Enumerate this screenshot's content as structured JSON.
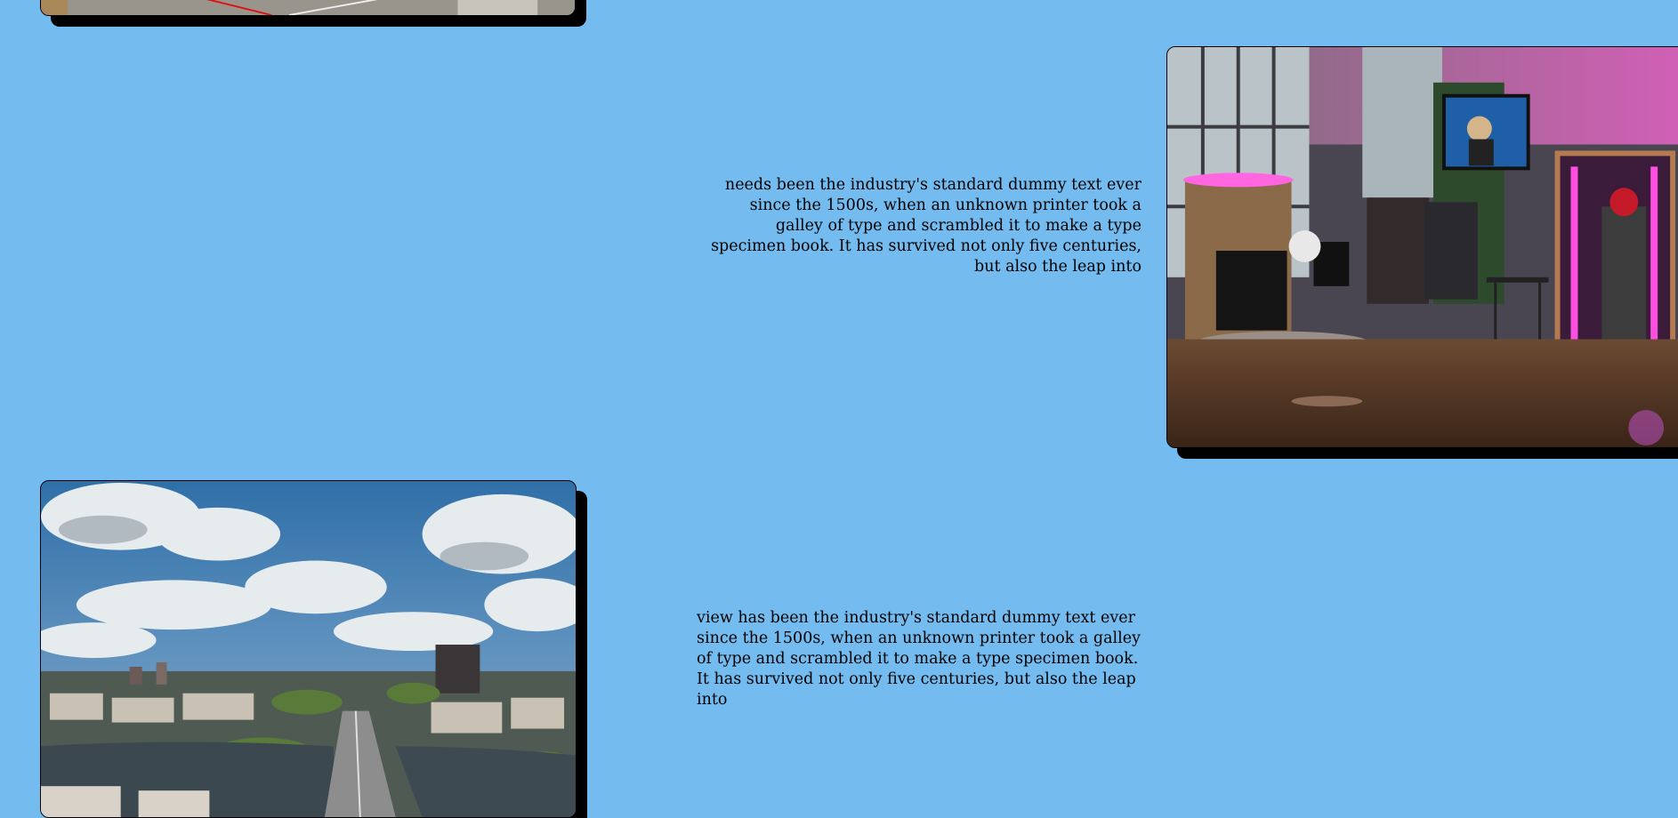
{
  "page": {
    "background_color": "#74bbef"
  },
  "top_card": {
    "image_alt": "road scene with painted lines"
  },
  "store_card": {
    "image_alt": "store interior with neon booth"
  },
  "city_card": {
    "image_alt": "aerial city view with clouds and canal"
  },
  "paragraph_1": {
    "text": "needs been the industry's standard dummy text ever since the 1500s, when an unknown printer took a galley of type and scrambled it to make a type specimen book. It has survived not only five centuries, but also the leap into"
  },
  "paragraph_2": {
    "text": "view has been the industry's standard dummy text ever since the 1500s, when an unknown printer took a galley of type and scrambled it to make a type specimen book. It has survived not only five centuries, but also the leap into"
  }
}
